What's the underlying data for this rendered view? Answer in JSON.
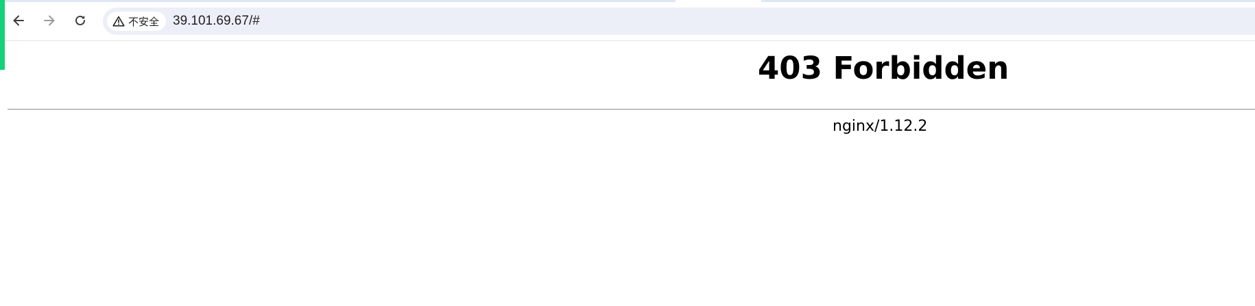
{
  "browser": {
    "security_label": "不安全",
    "url": "39.101.69.67/#",
    "icons": {
      "back": "arrow-left-icon",
      "forward": "arrow-right-icon",
      "reload": "reload-icon",
      "security": "warning-triangle-icon"
    },
    "accent_color": "#14d27a"
  },
  "page": {
    "title": "403 Forbidden",
    "server": "nginx/1.12.2"
  }
}
